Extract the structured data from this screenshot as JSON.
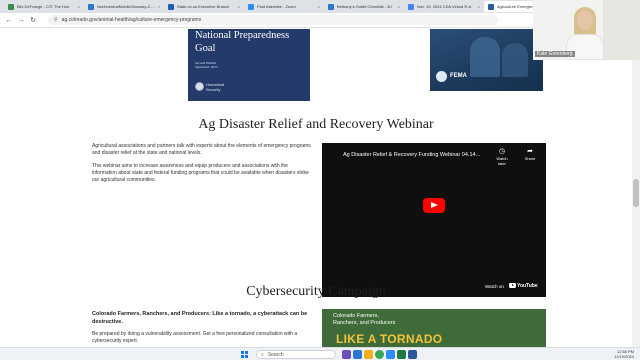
{
  "browser": {
    "tabs": [
      {
        "label": "Blix DeFrange - CIT: The Hon",
        "color": "#3b8a4e"
      },
      {
        "label": "NorthcentralMobileGlossary-2-22",
        "color": "#2b78d0"
      },
      {
        "label": "State.co.us Executive Branch",
        "color": "#1b5fb8"
      },
      {
        "label": "Post Attendee - Zoom",
        "color": "#2d8cff"
      },
      {
        "label": "Bethany's Outlet Checklist - 40",
        "color": "#2b78d0"
      },
      {
        "label": "Nov. 19, 2024 CDA Virtual R-A",
        "color": "#4285f4"
      },
      {
        "label": "Agriculture Emergen",
        "color": "#2a5c9a"
      }
    ],
    "address": "ag.colorado.gov/animal-health/ag/culture-emergency-programs"
  },
  "page": {
    "banner_left": {
      "title_line1": "National Preparedness",
      "title_line2": "Goal",
      "edition_line1": "Second Edition",
      "edition_line2": "September 2015",
      "agency_line1": "Homeland",
      "agency_line2": "Security"
    },
    "banner_right": {
      "agency": "FEMA"
    },
    "webinar": {
      "heading": "Ag Disaster Relief and Recovery Webinar",
      "para1": "Agricultural associations and partners talk with experts about the elements of emergency programs and disaster relief at the state and national levels.",
      "para2": "This webinar aims to increase awareness and equip producers and associations with the information about state and federal funding programs that could be available when disasters strike our agricultural communities."
    },
    "video": {
      "title": "Ag Disaster Relief & Recovery Funding Webinar 04.14...",
      "watch_later": "Watch later",
      "share": "Share",
      "watch_on": "Watch on",
      "youtube": "YouTube"
    },
    "cyber": {
      "heading": "Cybersecurity Campaign",
      "lead": "Colorado Farmers, Ranchers, and Producers: Like a tornado, a cyberattack can be destructive.",
      "para": "Be prepared by doing a vulnerability assessment. Get a free personalized consultation with a cybersecurity expert.",
      "img_line1": "Colorado Farmers,",
      "img_line2": "Ranchers, and Producers",
      "img_big": "LIKE A TORNADO"
    }
  },
  "webcam": {
    "name": "Kate Greenberg"
  },
  "taskbar": {
    "search_placeholder": "Search",
    "time": "12:58 PM",
    "date": "11/19/2024"
  }
}
